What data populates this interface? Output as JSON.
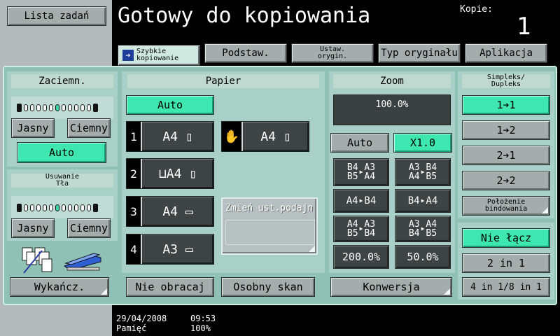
{
  "header": {
    "task_list_button": "Lista zadań",
    "status_title": "Gotowy do kopiowania",
    "copies_label": "Kopie:",
    "copies_value": "1"
  },
  "tabs": [
    {
      "label_line1": "Szybkie",
      "label_line2": "kopiowanie"
    },
    {
      "label": "Podstaw."
    },
    {
      "label_line1": "Ustaw.",
      "label_line2": "orygin."
    },
    {
      "label": "Typ oryginału"
    },
    {
      "label": "Aplikacja"
    }
  ],
  "density": {
    "title": "Zaciemn.",
    "light_button": "Jasny",
    "dark_button": "Ciemny",
    "auto_button": "Auto"
  },
  "background_removal": {
    "title_line1": "Usuwanie",
    "title_line2": "Tła",
    "light_button": "Jasny",
    "dark_button": "Ciemny"
  },
  "finishing_button": "Wykańcz.",
  "paper": {
    "title": "Papier",
    "auto_button": "Auto",
    "trays": [
      {
        "num": "1",
        "size": "A4"
      },
      {
        "num": "2",
        "size": "A4"
      },
      {
        "num": "3",
        "size": "A4"
      },
      {
        "num": "4",
        "size": "A3"
      }
    ],
    "bypass": {
      "size": "A4"
    },
    "change_tray_settings": "Zmień ust.podajn",
    "no_rotate_button": "Nie obracaj",
    "separate_scan_button": "Osobny skan"
  },
  "zoom": {
    "title": "Zoom",
    "display_value": "100.0%",
    "auto_button": "Auto",
    "x1_button": "X1.0",
    "ratios": [
      {
        "a1": "B4",
        "a2": "B5",
        "b1": "A3",
        "b2": "A4"
      },
      {
        "a1": "A3",
        "a2": "A4",
        "b1": "B4",
        "b2": "B5"
      },
      {
        "a1": "A4",
        "b1": "B4"
      },
      {
        "a1": "B4",
        "b1": "A4"
      },
      {
        "a1": "A4",
        "a2": "B5",
        "b1": "A3",
        "b2": "B4"
      },
      {
        "a1": "A3",
        "a2": "B4",
        "b1": "A4",
        "b2": "B5"
      }
    ],
    "preset_200": "200.0%",
    "preset_50": "50.0%",
    "conversion_button": "Konwersja"
  },
  "duplex": {
    "title_line1": "Simpleks/",
    "title_line2": "Dupleks",
    "opt1": "1➔1",
    "opt2": "1➔2",
    "opt3": "2➔1",
    "opt4": "2➔2",
    "binding_line1": "Położenie",
    "binding_line2": "bindowania"
  },
  "combine": {
    "no_combine": "Nie łącz",
    "two_in_one": "2 in 1",
    "four_in_one": "4 in 1/8 in 1"
  },
  "status": {
    "date": "29/04/2008",
    "time": "09:53",
    "memory_label": "Pamięć",
    "memory_value": "100%"
  }
}
